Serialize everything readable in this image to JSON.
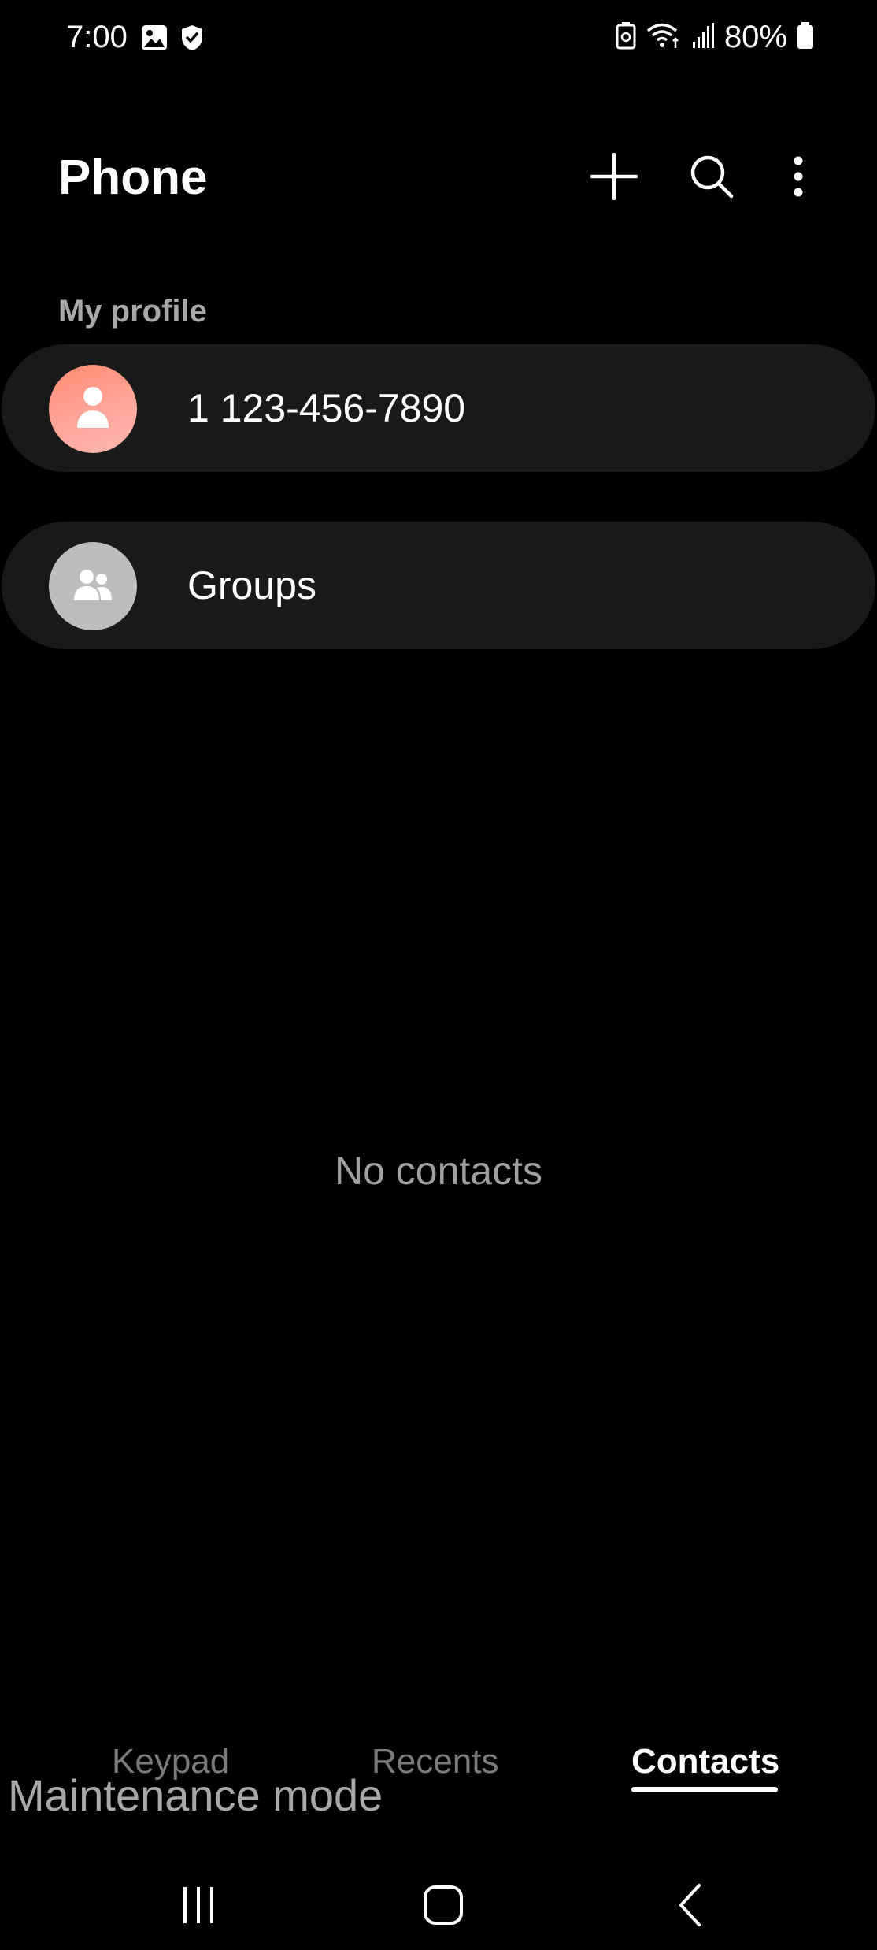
{
  "status_bar": {
    "time": "7:00",
    "left_icons": [
      "gallery-icon",
      "shield-icon"
    ],
    "right_icons": [
      "battery-saver-icon",
      "wifi-icon",
      "signal-icon",
      "battery-icon"
    ],
    "battery_percent": "80%"
  },
  "header": {
    "title": "Phone",
    "actions": [
      "add-icon",
      "search-icon",
      "more-options-icon"
    ]
  },
  "profile_section": {
    "label": "My profile",
    "profile_name": "1 123-456-7890"
  },
  "groups": {
    "label": "Groups"
  },
  "empty_state": {
    "text": "No contacts"
  },
  "tabs": [
    {
      "label": "Keypad",
      "selected": false
    },
    {
      "label": "Recents",
      "selected": false
    },
    {
      "label": "Contacts",
      "selected": true
    }
  ],
  "overlay": {
    "maintenance_text": "Maintenance mode"
  },
  "colors": {
    "background": "#000000",
    "row_background": "#191919",
    "profile_avatar": "#ff9c86",
    "groups_avatar": "#bdbdbd",
    "muted_text": "#a0a0a0"
  }
}
